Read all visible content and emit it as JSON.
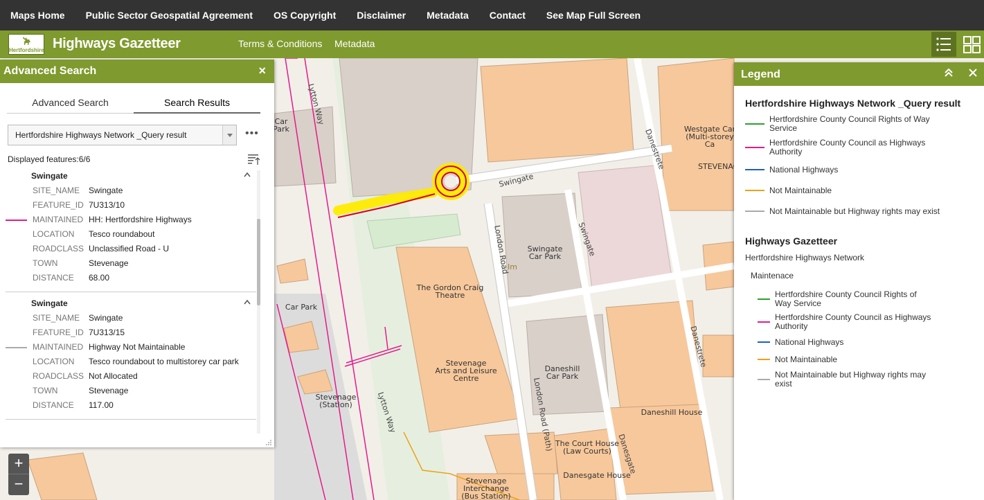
{
  "topnav": {
    "items": [
      "Maps Home",
      "Public Sector Geospatial Agreement",
      "OS Copyright",
      "Disclaimer",
      "Metadata",
      "Contact",
      "See Map Full Screen"
    ]
  },
  "header": {
    "logo_text": "Hertfordshire",
    "title": "Highways Gazetteer",
    "links": [
      "Terms & Conditions",
      "Metadata"
    ]
  },
  "map": {
    "labels": {
      "car_park_top": "Car\nPark",
      "westgate": "Westgate Car\n(Multi-storey Ca",
      "stevenage_top": "STEVENAG",
      "swingate_car_park": "Swingate\nCar Park",
      "gordon_craig": "The Gordon Craig\nTheatre",
      "arts_centre": "Stevenage\nArts and Leisure\nCentre",
      "car_park_left": "Car Park",
      "daneshill_car_park": "Daneshill\nCar Park",
      "daneshill_house": "Daneshill House",
      "stevenage_station": "Stevenage\n(Station)",
      "court_house": "The Court House\n(Law Courts)",
      "danesgate_house": "Danesgate House",
      "interchange": "Stevenage Interchange\n(Bus Station)",
      "im": "Im"
    },
    "roads": {
      "lytton_way_top": "Lytton Way",
      "lytton_way_bottom": "Lytton Way",
      "swingate_h": "Swingate",
      "swingate_v": "Swingate",
      "london_road": "London Road",
      "london_road_path": "London Road (Path)",
      "danestrete_top": "Danestrete",
      "danestrete_bottom": "Danestrete",
      "danesgate": "Danesgate"
    },
    "zoom_in": "+",
    "zoom_out": "−"
  },
  "advanced_search": {
    "title": "Advanced Search",
    "close": "×",
    "tabs": [
      "Advanced Search",
      "Search Results"
    ],
    "active_tab": "Search Results",
    "layer_select": "Hertfordshire Highways Network _Query result",
    "more": "•••",
    "displayed": "Displayed features:6/6",
    "results": [
      {
        "name": "Swingate",
        "symbol_color": "#e6198c",
        "fields": [
          [
            "SITE_NAME",
            "Swingate"
          ],
          [
            "FEATURE_ID",
            "7U313/10"
          ],
          [
            "MAINTAINED",
            "HH: Hertfordshire Highways"
          ],
          [
            "LOCATION",
            "Tesco roundabout"
          ],
          [
            "ROADCLASS",
            "Unclassified Road - U"
          ],
          [
            "TOWN",
            "Stevenage"
          ],
          [
            "DISTANCE",
            "68.00"
          ]
        ]
      },
      {
        "name": "Swingate",
        "symbol_color": "#aaaaaa",
        "fields": [
          [
            "SITE_NAME",
            "Swingate"
          ],
          [
            "FEATURE_ID",
            "7U313/15"
          ],
          [
            "MAINTAINED",
            "Highway Not Maintainable"
          ],
          [
            "LOCATION",
            "Tesco roundabout to multistorey car park"
          ],
          [
            "ROADCLASS",
            "Not Allocated"
          ],
          [
            "TOWN",
            "Stevenage"
          ],
          [
            "DISTANCE",
            "117.00"
          ]
        ]
      }
    ]
  },
  "legend": {
    "title": "Legend",
    "layer1": {
      "name": "Hertfordshire Highways Network _Query result",
      "items": [
        {
          "label": "Hertfordshire County Council Rights of Way Service",
          "color": "#2ca02c"
        },
        {
          "label": "Hertfordshire County Council as Highways Authority",
          "color": "#e6198c"
        },
        {
          "label": "National Highways",
          "color": "#1f5fbf"
        },
        {
          "label": "Not Maintainable",
          "color": "#e8a317"
        },
        {
          "label": "Not Maintainable but Highway rights may exist",
          "color": "#aaaaaa"
        }
      ]
    },
    "layer2": {
      "name": "Highways Gazetteer",
      "sub": "Hertfordshire Highways Network",
      "sub2": "Maintenace",
      "items": [
        {
          "label": "Hertfordshire County Council Rights of Way Service",
          "color": "#2ca02c"
        },
        {
          "label": "Hertfordshire County Council as Highways Authority",
          "color": "#e6198c"
        },
        {
          "label": "National Highways",
          "color": "#1f5fbf"
        },
        {
          "label": "Not Maintainable",
          "color": "#e8a317"
        },
        {
          "label": "Not Maintainable but Highway rights may exist",
          "color": "#aaaaaa"
        }
      ]
    }
  },
  "colors": {
    "brand_green": "#7f9a2e",
    "nav_dark": "#333333",
    "building": "#f7c89b",
    "highlight": "#ffeb00"
  }
}
